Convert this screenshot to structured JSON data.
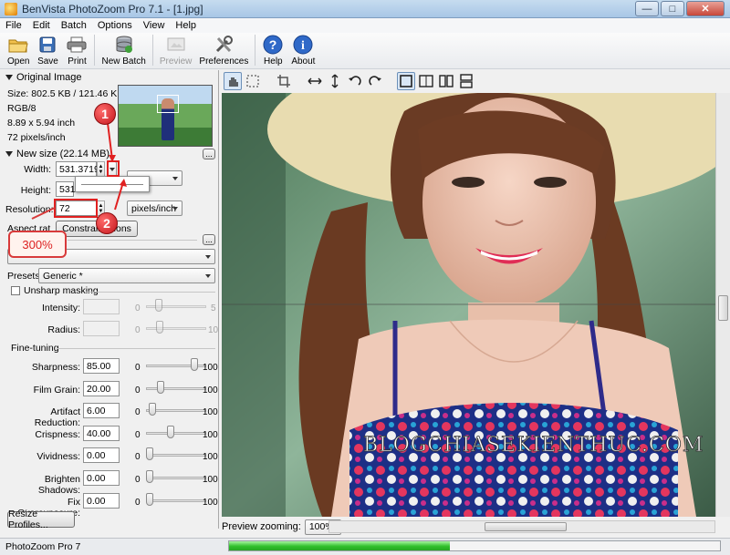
{
  "window": {
    "title": "BenVista PhotoZoom Pro 7.1 - [1.jpg]"
  },
  "menu": [
    "File",
    "Edit",
    "Batch",
    "Options",
    "View",
    "Help"
  ],
  "toolbar": {
    "open": "Open",
    "save": "Save",
    "print": "Print",
    "new_batch": "New Batch",
    "preview": "Preview",
    "preferences": "Preferences",
    "help": "Help",
    "about": "About"
  },
  "original": {
    "header": "Original Image",
    "size": "Size: 802.5 KB / 121.46 KB",
    "mode": "RGB/8",
    "dimensions": "8.89 x 5.94 inch",
    "ppi": "72 pixels/inch"
  },
  "newsize": {
    "header": "New size (22.14 MB)",
    "more_button": "...",
    "width_label": "Width:",
    "width_value": "531.3719",
    "height_label": "Height:",
    "height_value": "531.",
    "resolution_label": "Resolution:",
    "resolution_value": "72",
    "resolution_unit": "pixels/inch",
    "aspect_label": "Aspect rat",
    "aspect_button": "Constrain...tions",
    "method_more_button": "..."
  },
  "presets": {
    "label": "Presets:",
    "value": "Generic *"
  },
  "unsharp": {
    "label": "Unsharp masking",
    "intensity_label": "Intensity:",
    "intensity_min": "0",
    "intensity_max": "5",
    "radius_label": "Radius:",
    "radius_min": "0",
    "radius_max": "10"
  },
  "finetuning": {
    "header": "Fine-tuning",
    "rows": [
      {
        "label": "Sharpness:",
        "value": "85.00",
        "min": "0",
        "max": "100",
        "level": 0.85
      },
      {
        "label": "Film Grain:",
        "value": "20.00",
        "min": "0",
        "max": "100",
        "level": 0.2
      },
      {
        "label": "Artifact Reduction:",
        "value": "6.00",
        "min": "0",
        "max": "100",
        "level": 0.06
      },
      {
        "label": "Crispness:",
        "value": "40.00",
        "min": "0",
        "max": "100",
        "level": 0.4
      },
      {
        "label": "Vividness:",
        "value": "0.00",
        "min": "0",
        "max": "100",
        "level": 0
      },
      {
        "label": "Brighten Shadows:",
        "value": "0.00",
        "min": "0",
        "max": "100",
        "level": 0
      },
      {
        "label": "Fix Overexposure:",
        "value": "0.00",
        "min": "0",
        "max": "100",
        "level": 0
      }
    ]
  },
  "resize_profiles": "Resize Profiles...",
  "preview_zoom": {
    "label": "Preview zooming:",
    "value": "100%"
  },
  "status": {
    "text": "PhotoZoom Pro 7",
    "progress": 0.45
  },
  "annotations": {
    "badge1": "1",
    "badge2": "2",
    "callout": "300%"
  },
  "watermark": "BLOGCHIASEKIENTHUC.COM",
  "colors": {
    "accent_red": "#e02020",
    "progress_green": "#2fbf2a"
  }
}
